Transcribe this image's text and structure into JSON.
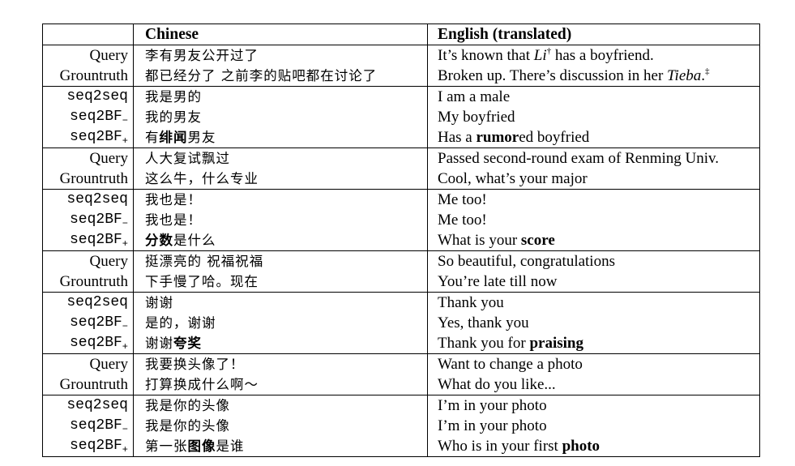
{
  "header": {
    "label": "",
    "chinese": "Chinese",
    "english": "English (translated)"
  },
  "rows": [
    {
      "label": "Query",
      "zh": [
        {
          "t": "李有男友公开过了"
        }
      ],
      "en": [
        {
          "t": "It’s known that "
        },
        {
          "t": "Li",
          "i": true
        },
        {
          "t": "†",
          "sup": true
        },
        {
          "t": " has a boyfriend."
        }
      ]
    },
    {
      "label": "Grountruth",
      "zh": [
        {
          "t": "都已经分了 之前李的贴吧都在讨论了"
        }
      ],
      "en": [
        {
          "t": "Broken up. There’s discussion in her "
        },
        {
          "t": "Tieba",
          "i": true
        },
        {
          "t": "."
        },
        {
          "t": "‡",
          "sup": true
        }
      ]
    },
    {
      "label": "seq2seq",
      "zh": [
        {
          "t": "我是男的"
        }
      ],
      "en": [
        {
          "t": "I am a male"
        }
      ]
    },
    {
      "label": "seq2BF",
      "label_sub": "−",
      "zh": [
        {
          "t": "我的男友"
        }
      ],
      "en": [
        {
          "t": "My boyfried"
        }
      ]
    },
    {
      "label": "seq2BF",
      "label_sub": "+",
      "zh": [
        {
          "t": "有"
        },
        {
          "t": "绯闻",
          "b": true
        },
        {
          "t": "男友"
        }
      ],
      "en": [
        {
          "t": "Has a "
        },
        {
          "t": "rumor",
          "b": true
        },
        {
          "t": "ed boyfried"
        }
      ]
    },
    {
      "label": "Query",
      "zh": [
        {
          "t": "人大复试飘过"
        }
      ],
      "en": [
        {
          "t": "Passed second-round exam of Renming Univ."
        }
      ]
    },
    {
      "label": "Grountruth",
      "zh": [
        {
          "t": "这么牛，什么专业"
        }
      ],
      "en": [
        {
          "t": "Cool, what’s your major"
        }
      ]
    },
    {
      "label": "seq2seq",
      "zh": [
        {
          "t": "我也是！"
        }
      ],
      "en": [
        {
          "t": "Me too!"
        }
      ]
    },
    {
      "label": "seq2BF",
      "label_sub": "−",
      "zh": [
        {
          "t": "我也是！"
        }
      ],
      "en": [
        {
          "t": "Me too!"
        }
      ]
    },
    {
      "label": "seq2BF",
      "label_sub": "+",
      "zh": [
        {
          "t": "分数",
          "b": true
        },
        {
          "t": "是什么"
        }
      ],
      "en": [
        {
          "t": "What is your "
        },
        {
          "t": "score",
          "b": true
        }
      ]
    },
    {
      "label": "Query",
      "zh": [
        {
          "t": "挺漂亮的 祝福祝福"
        }
      ],
      "en": [
        {
          "t": "So beautiful, congratulations"
        }
      ]
    },
    {
      "label": "Grountruth",
      "zh": [
        {
          "t": "下手慢了哈。现在"
        }
      ],
      "en": [
        {
          "t": "You’re late till now"
        }
      ]
    },
    {
      "label": "seq2seq",
      "zh": [
        {
          "t": "谢谢"
        }
      ],
      "en": [
        {
          "t": "Thank you"
        }
      ]
    },
    {
      "label": "seq2BF",
      "label_sub": "−",
      "zh": [
        {
          "t": "是的，谢谢"
        }
      ],
      "en": [
        {
          "t": "Yes, thank you"
        }
      ]
    },
    {
      "label": "seq2BF",
      "label_sub": "+",
      "zh": [
        {
          "t": "谢谢"
        },
        {
          "t": "夸奖",
          "b": true
        }
      ],
      "en": [
        {
          "t": "Thank you for "
        },
        {
          "t": "praising",
          "b": true
        }
      ]
    },
    {
      "label": "Query",
      "zh": [
        {
          "t": "我要换头像了！"
        }
      ],
      "en": [
        {
          "t": "Want to change a photo"
        }
      ]
    },
    {
      "label": "Grountruth",
      "zh": [
        {
          "t": "打算换成什么啊～"
        }
      ],
      "en": [
        {
          "t": "What do you like..."
        }
      ]
    },
    {
      "label": "seq2seq",
      "zh": [
        {
          "t": "我是你的头像"
        }
      ],
      "en": [
        {
          "t": "I’m in your photo"
        }
      ]
    },
    {
      "label": "seq2BF",
      "label_sub": "−",
      "zh": [
        {
          "t": "我是你的头像"
        }
      ],
      "en": [
        {
          "t": "I’m in your photo"
        }
      ]
    },
    {
      "label": "seq2BF",
      "label_sub": "+",
      "zh": [
        {
          "t": "第一张"
        },
        {
          "t": "图像",
          "b": true
        },
        {
          "t": "是谁"
        }
      ],
      "en": [
        {
          "t": "Who is in your first "
        },
        {
          "t": "photo",
          "b": true
        }
      ]
    }
  ]
}
